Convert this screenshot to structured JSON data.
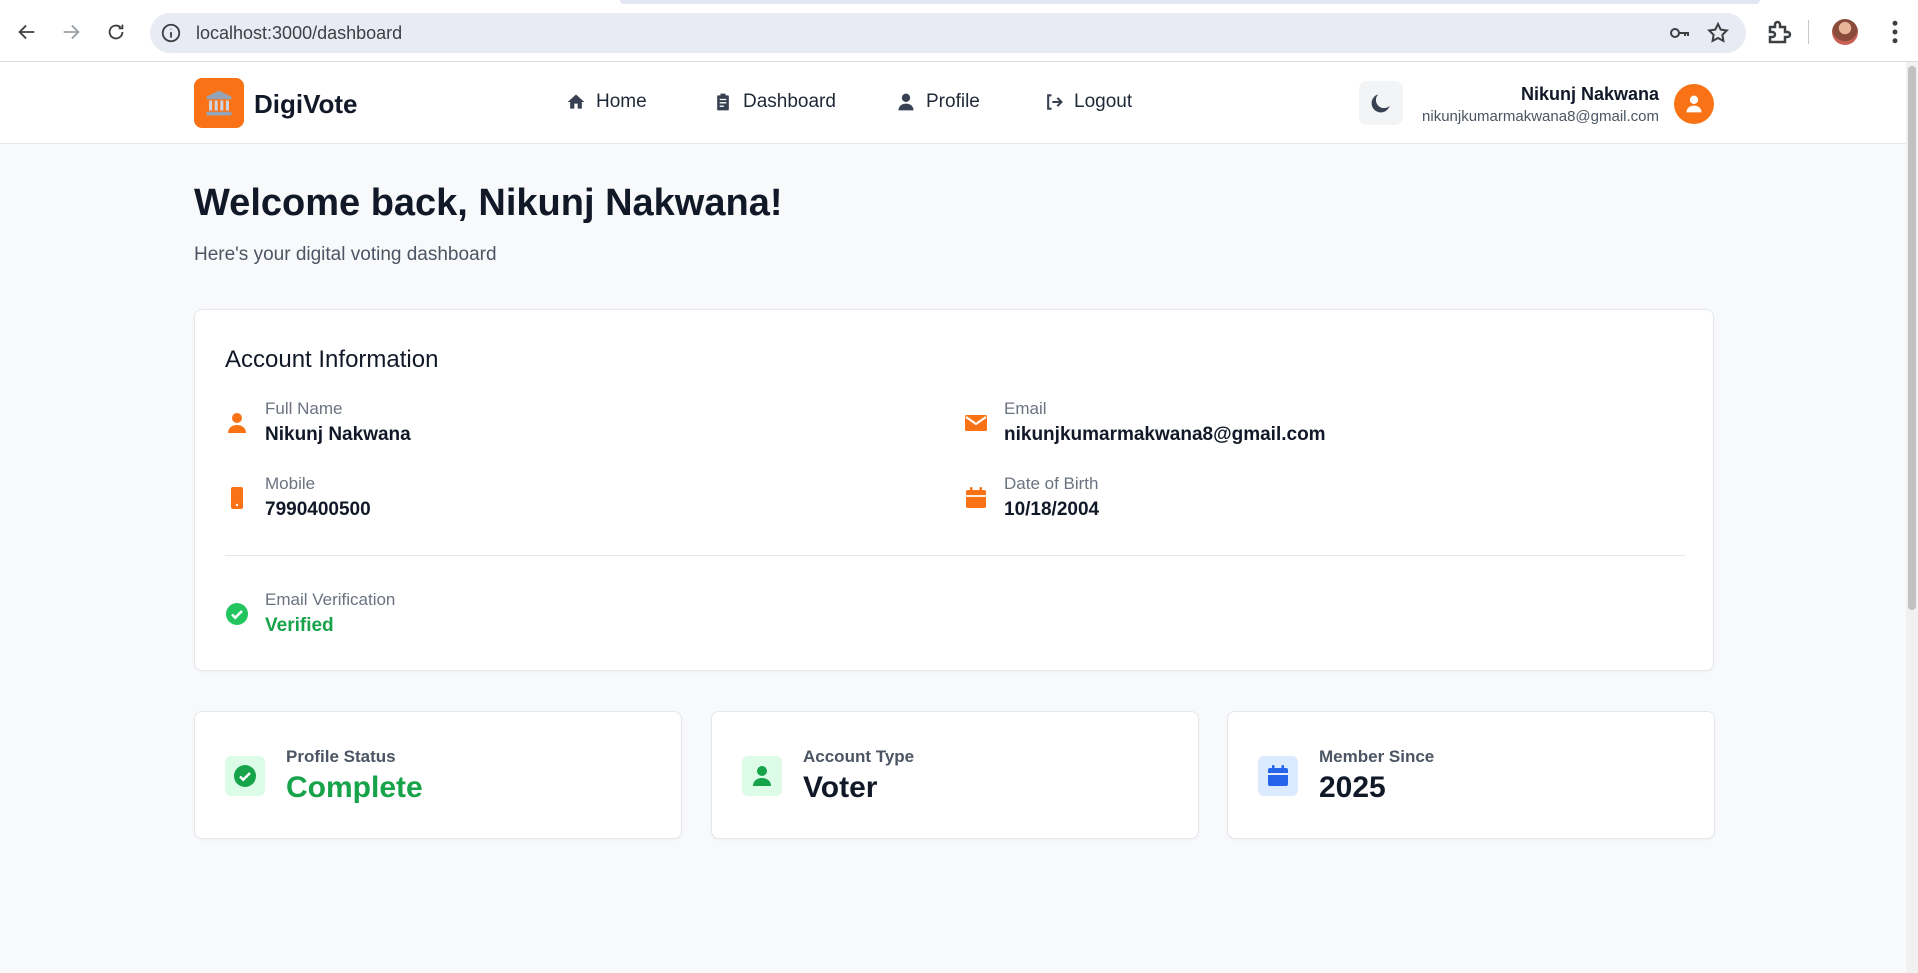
{
  "browser": {
    "url": "localhost:3000/dashboard"
  },
  "nav": {
    "brand": "DigiVote",
    "links": [
      {
        "label": "Home",
        "icon": "home-icon"
      },
      {
        "label": "Dashboard",
        "icon": "clipboard-icon"
      },
      {
        "label": "Profile",
        "icon": "user-icon"
      },
      {
        "label": "Logout",
        "icon": "logout-icon"
      }
    ],
    "user": {
      "name": "Nikunj Nakwana",
      "email": "nikunjkumarmakwana8@gmail.com"
    }
  },
  "main": {
    "welcome": "Welcome back, Nikunj Nakwana!",
    "subtitle": "Here's your digital voting dashboard"
  },
  "account": {
    "title": "Account Information",
    "full_name_label": "Full Name",
    "full_name": "Nikunj Nakwana",
    "email_label": "Email",
    "email": "nikunjkumarmakwana8@gmail.com",
    "mobile_label": "Mobile",
    "mobile": "7990400500",
    "dob_label": "Date of Birth",
    "dob": "10/18/2004",
    "verification_label": "Email Verification",
    "verification_status": "Verified"
  },
  "stats": [
    {
      "label": "Profile Status",
      "value": "Complete",
      "icon": "check-circle-icon"
    },
    {
      "label": "Account Type",
      "value": "Voter",
      "icon": "user-icon"
    },
    {
      "label": "Member Since",
      "value": "2025",
      "icon": "calendar-icon"
    }
  ],
  "colors": {
    "accent": "#f97316",
    "success": "#16a34a",
    "success_bg": "#dcfce7",
    "info": "#2563eb",
    "info_bg": "#dbeafe"
  }
}
